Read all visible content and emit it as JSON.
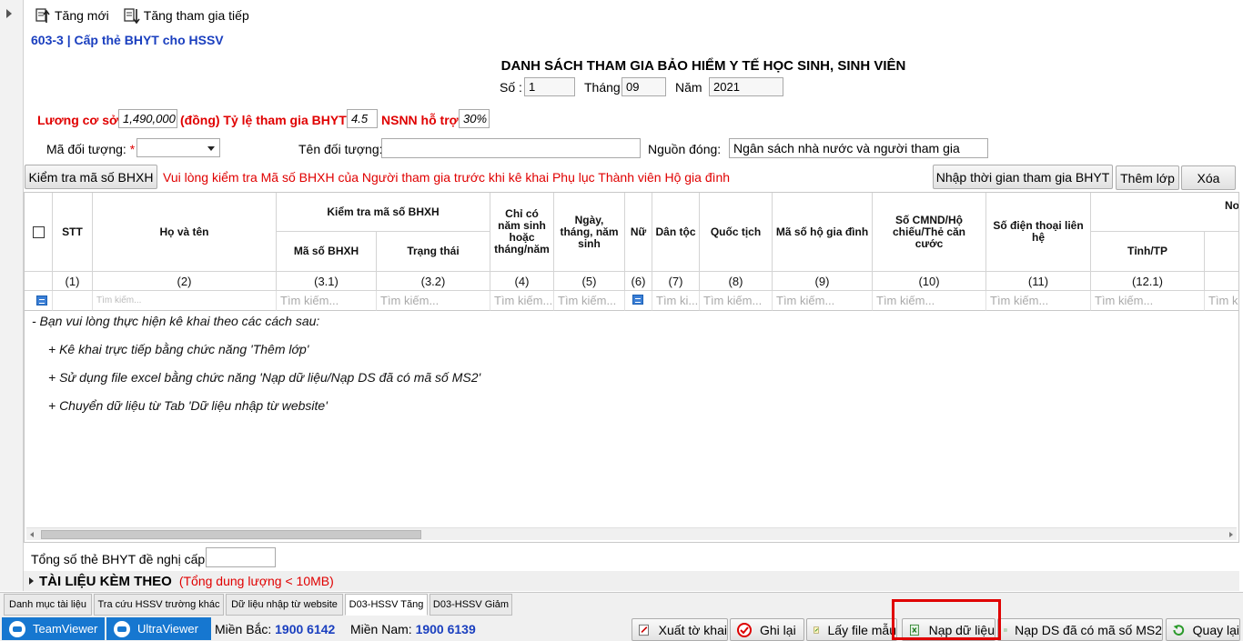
{
  "toolbar": {
    "new_label": "Tăng mới",
    "continue_label": "Tăng tham gia tiếp"
  },
  "form": {
    "code_title": "603-3 | Cấp thẻ BHYT cho HSSV",
    "title": "DANH SÁCH THAM GIA BẢO HIỂM Y TẾ HỌC SINH, SINH VIÊN",
    "so_label": "Số :",
    "so_value": "1",
    "thang_label": "Tháng",
    "thang_value": "09",
    "nam_label": "Năm",
    "nam_value": "2021",
    "luong_label": "Lương cơ sở",
    "luong_value": "1,490,000",
    "dong_label": "(đồng) Tỷ lệ tham gia BHYT",
    "tyle_value": "4.5",
    "nsnn_label": "NSNN hỗ trợ",
    "nsnn_value": "30%",
    "ma_doi_tuong_label": "Mã đối tượng:",
    "required_mark": "*",
    "ma_doi_tuong_value": "",
    "ten_doi_tuong_label": "Tên đối tượng:",
    "ten_doi_tuong_value": "",
    "nguon_dong_label": "Nguồn đóng:",
    "nguon_dong_value": "Ngân sách nhà nước và người tham gia"
  },
  "actions": {
    "check_bhxh": "Kiểm tra mã số BHXH",
    "warning": "Vui lòng kiểm tra Mã số BHXH của Người tham gia trước khi kê khai Phụ lục Thành viên Hộ gia đình",
    "import_time": "Nhập thời gian tham gia BHYT",
    "add_class": "Thêm lớp",
    "delete": "Xóa"
  },
  "grid": {
    "headers": {
      "stt": "STT",
      "ho_ten": "Họ và tên",
      "kiem_tra": "Kiểm tra mã số BHXH",
      "ma_so": "Mã số BHXH",
      "trang_thai": "Trạng thái",
      "chi_co_nam": "Chỉ có năm sinh hoặc tháng/năm",
      "ngay_sinh": "Ngày, tháng, năm sinh",
      "nu": "Nữ",
      "dan_toc": "Dân tộc",
      "quoc_tich": "Quốc tịch",
      "ma_ho": "Mã số hộ gia đình",
      "cmnd": "Số CMND/Hộ chiếu/Thẻ căn cước",
      "sdt": "Số điện thoại liên hệ",
      "tinh": "Tỉnh/TP",
      "cut_top": "No",
      "cut_paren": "("
    },
    "numbers": [
      "(1)",
      "(2)",
      "(3.1)",
      "(3.2)",
      "(4)",
      "(5)",
      "(6)",
      "(7)",
      "(8)",
      "(9)",
      "(10)",
      "(11)",
      "(12.1)"
    ],
    "search_placeholder": "Tìm kiếm...",
    "search_short": "Tìm ki...",
    "search_cut": "Tìm k",
    "instructions": [
      "- Bạn vui lòng thực hiện kê khai theo các cách sau:",
      "+ Kê khai trực tiếp bằng chức năng 'Thêm lớp'",
      "+ Sử dụng file excel bằng chức năng 'Nạp dữ liệu/Nạp DS đã có mã số MS2'",
      "+ Chuyển dữ liệu từ Tab 'Dữ liệu nhập từ website'"
    ]
  },
  "footer": {
    "total_label": "Tổng số thẻ BHYT đề nghị cấp:",
    "total_value": "",
    "attach_title": "TÀI LIỆU KÈM THEO",
    "attach_note": "(Tổng dung lượng < 10MB)"
  },
  "tabs": [
    {
      "label": "Danh mục tài liệu"
    },
    {
      "label": "Tra cứu HSSV trường khác"
    },
    {
      "label": "Dữ liệu nhập từ website"
    },
    {
      "label": "D03-HSSV Tăng"
    },
    {
      "label": "D03-HSSV Giảm"
    }
  ],
  "status": {
    "teamviewer": "TeamViewer",
    "ultraviewer": "UltraViewer",
    "bac_label": "Miền Bắc:",
    "bac_phone": "1900 6142",
    "nam_label": "Miền Nam:",
    "nam_phone": "1900 6139"
  },
  "buttons": {
    "export": "Xuất tờ khai",
    "save": "Ghi lại",
    "template": "Lấy file mẫu",
    "load": "Nạp dữ liệu",
    "load_ms2": "Nạp DS đã có mã số MS2",
    "back": "Quay lại"
  },
  "colors": {
    "accent_blue": "#1a3fbf",
    "warning_red": "#e00000",
    "teamviewer_blue": "#1677d0"
  }
}
